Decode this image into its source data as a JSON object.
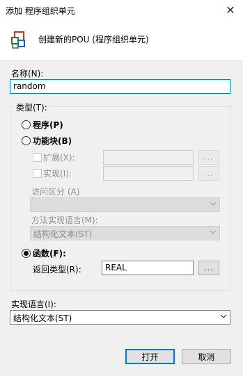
{
  "window": {
    "title": "添加 程序组织单元",
    "close_glyph": "✕"
  },
  "header": {
    "text": "创建新的POU (程序组织单元)",
    "icon": "pou-icon"
  },
  "name_field": {
    "label": "名称(N):",
    "value": "random"
  },
  "type_group": {
    "label": "类型(T):"
  },
  "program": {
    "label": "程序(P)",
    "checked": false
  },
  "function_block": {
    "label": "功能块(B)",
    "checked": false
  },
  "extends": {
    "label": "扩展(X):",
    "value": "",
    "button": "..."
  },
  "implements": {
    "label": "实现(I):",
    "value": "",
    "button": "..."
  },
  "access": {
    "label": "访问区分 (A)",
    "value": ""
  },
  "method_lang": {
    "label": "方法实现语言(M):",
    "value": "结构化文本(ST)"
  },
  "function": {
    "label": "函数(F):",
    "checked": true
  },
  "return_type": {
    "label": "返回类型(R):",
    "value": "REAL",
    "button": "..."
  },
  "impl_lang": {
    "label": "实现语言(I):",
    "value": "结构化文本(ST)"
  },
  "buttons": {
    "open": "打开",
    "cancel": "取消"
  },
  "colors": {
    "accent": "#0078d7",
    "icon_red": "#c0392b",
    "icon_green": "#2e7d32",
    "icon_blue": "#1565c0"
  }
}
